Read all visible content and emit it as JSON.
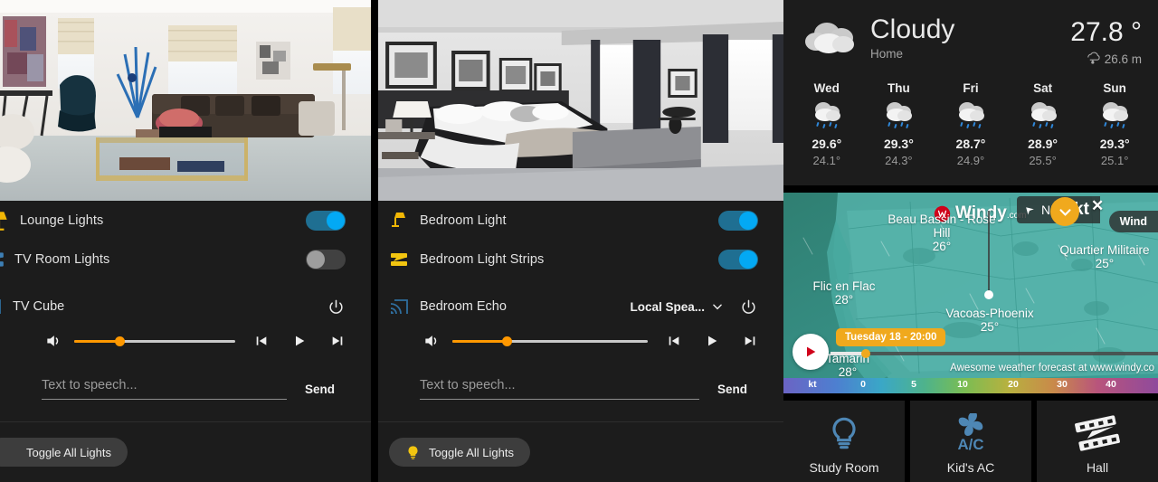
{
  "panels": {
    "lounge": {
      "photo_alt": "living-room-photo",
      "lights": [
        {
          "name": "Lounge Lights",
          "icon": "floor-lamp-icon",
          "state": "on"
        },
        {
          "name": "TV Room Lights",
          "icon": "light-strip-icon",
          "state": "off"
        }
      ],
      "media": {
        "title": "TV Cube",
        "cast_icon": "cast-icon",
        "power_icon": "power-icon",
        "volume_percent": 28,
        "tts_placeholder": "Text to speech...",
        "send_label": "Send"
      },
      "toggle_all_label": "Toggle All Lights"
    },
    "bedroom": {
      "photo_alt": "bedroom-photo",
      "lights": [
        {
          "name": "Bedroom Light",
          "icon": "wall-lamp-icon",
          "state": "on"
        },
        {
          "name": "Bedroom Light Strips",
          "icon": "light-strip-icon",
          "state": "on"
        }
      ],
      "media": {
        "title": "Bedroom Echo",
        "cast_icon": "cast-icon",
        "source": "Local Spea...",
        "power_icon": "power-icon",
        "volume_percent": 28,
        "tts_placeholder": "Text to speech...",
        "send_label": "Send"
      },
      "toggle_all_label": "Toggle All Lights"
    }
  },
  "weather": {
    "condition": "Cloudy",
    "location": "Home",
    "temperature": "27.8 °",
    "precipitation": "26.6 m",
    "precip_icon": "rain-drop-icon",
    "condition_icon": "cloud-icon",
    "forecast": [
      {
        "day": "Wed",
        "icon": "rainy-icon",
        "high": "29.6°",
        "low": "24.1°"
      },
      {
        "day": "Thu",
        "icon": "rainy-icon",
        "high": "29.3°",
        "low": "24.3°"
      },
      {
        "day": "Fri",
        "icon": "rainy-icon",
        "high": "28.7°",
        "low": "24.9°"
      },
      {
        "day": "Sat",
        "icon": "rainy-icon",
        "high": "28.9°",
        "low": "25.5°"
      },
      {
        "day": "Sun",
        "icon": "rainy-icon",
        "high": "29.3°",
        "low": "25.1°"
      }
    ]
  },
  "windy": {
    "logo_text": "Windy",
    "logo_suffix": ".com",
    "wind_direction": "NE",
    "wind_speed": "8kt",
    "layer_pill": "Wind",
    "close_label": "✕",
    "timestamp": "Tuesday 18 - 20:00",
    "credit": "Awesome weather forecast at www.windy.co",
    "scale_unit": "kt",
    "scale_ticks": [
      "0",
      "5",
      "10",
      "20",
      "30",
      "40"
    ],
    "places": [
      {
        "name": "Beau Bassin - Rose",
        "name2": "Hill",
        "temp": "26°"
      },
      {
        "name": "Quartier Militaire",
        "temp": "25°"
      },
      {
        "name": "Flic en Flac",
        "temp": "28°"
      },
      {
        "name": "Vacoas-Phoenix",
        "temp": "25°"
      },
      {
        "name": "Tamarin",
        "temp": "28°"
      }
    ]
  },
  "rooms": [
    {
      "name": "Study Room",
      "icon": "lightbulb-icon",
      "color": "#4e87b5"
    },
    {
      "name": "Kid's AC",
      "icon": "ac-fan-icon",
      "color": "#4e87b5"
    },
    {
      "name": "Hall",
      "icon": "light-strip-icon",
      "color": "#f2f2f2"
    }
  ]
}
